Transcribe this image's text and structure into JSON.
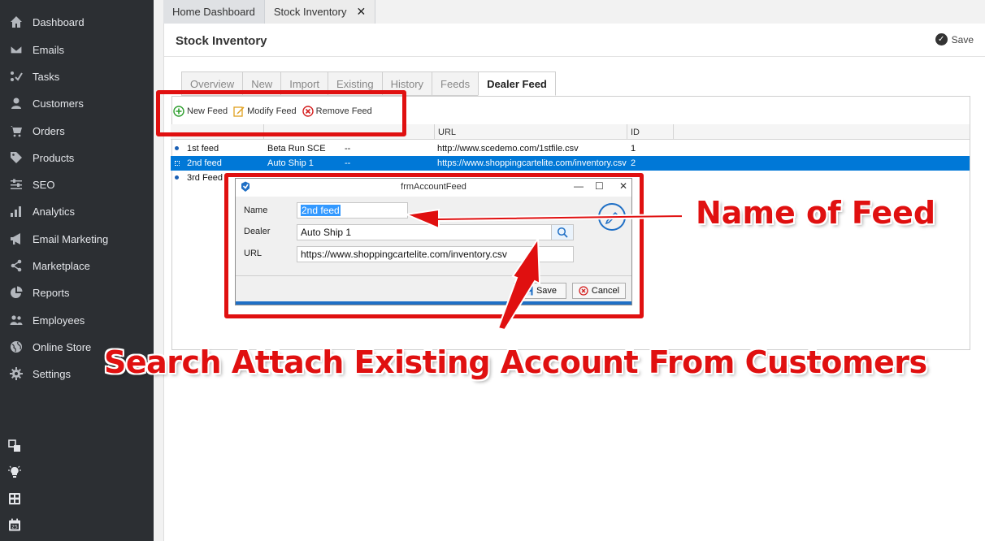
{
  "sidebar": {
    "items": [
      {
        "label": "Dashboard",
        "icon": "home-icon"
      },
      {
        "label": "Emails",
        "icon": "envelope-icon"
      },
      {
        "label": "Tasks",
        "icon": "tasks-icon"
      },
      {
        "label": "Customers",
        "icon": "user-icon"
      },
      {
        "label": "Orders",
        "icon": "cart-icon"
      },
      {
        "label": "Products",
        "icon": "tag-icon"
      },
      {
        "label": "SEO",
        "icon": "sliders-icon"
      },
      {
        "label": "Analytics",
        "icon": "bar-chart-icon"
      },
      {
        "label": "Email Marketing",
        "icon": "megaphone-icon"
      },
      {
        "label": "Marketplace",
        "icon": "share-icon"
      },
      {
        "label": "Reports",
        "icon": "pie-chart-icon"
      },
      {
        "label": "Employees",
        "icon": "users-icon"
      },
      {
        "label": "Online Store",
        "icon": "globe-icon"
      },
      {
        "label": "Settings",
        "icon": "gear-icon"
      }
    ],
    "bottom_icons": [
      "windows-icon",
      "lightbulb-icon",
      "calculator-icon",
      "calendar-icon"
    ]
  },
  "tabs": {
    "items": [
      {
        "label": "Home Dashboard"
      },
      {
        "label": "Stock Inventory",
        "closable": true
      }
    ],
    "close_glyph": "✕"
  },
  "page": {
    "title": "Stock Inventory",
    "save_label": "Save"
  },
  "subtabs": [
    "Overview",
    "New",
    "Import",
    "Existing",
    "History",
    "Feeds",
    "Dealer Feed"
  ],
  "active_subtab": "Dealer Feed",
  "toolbar": {
    "new_feed": "New Feed",
    "modify_feed": "Modify Feed",
    "remove_feed": "Remove Feed"
  },
  "grid": {
    "columns": [
      "URL",
      "ID"
    ],
    "rows": [
      {
        "name": "1st feed",
        "dealer": "Beta Run SCE",
        "col3": "--",
        "url": "http://www.scedemo.com/1stfile.csv",
        "id": "1",
        "selected": false
      },
      {
        "name": "2nd feed",
        "dealer": "Auto Ship 1",
        "col3": "--",
        "url": "https://www.shoppingcartelite.com/inventory.csv",
        "id": "2",
        "selected": true
      },
      {
        "name": "3rd Feed",
        "dealer": "",
        "col3": "",
        "url": "",
        "id": "",
        "selected": false
      }
    ]
  },
  "dialog": {
    "title": "frmAccountFeed",
    "name_label": "Name",
    "name_value": "2nd feed",
    "dealer_label": "Dealer",
    "dealer_value": "Auto Ship 1",
    "url_label": "URL",
    "url_value": "https://www.shoppingcartelite.com/inventory.csv",
    "save_label": "Save",
    "cancel_label": "Cancel",
    "minimize_glyph": "—",
    "maximize_glyph": "☐",
    "close_glyph": "✕"
  },
  "annotations": {
    "name_of_feed": "Name of Feed",
    "search_attach": "Search Attach Existing Account From Customers",
    "color": "#e01010"
  }
}
